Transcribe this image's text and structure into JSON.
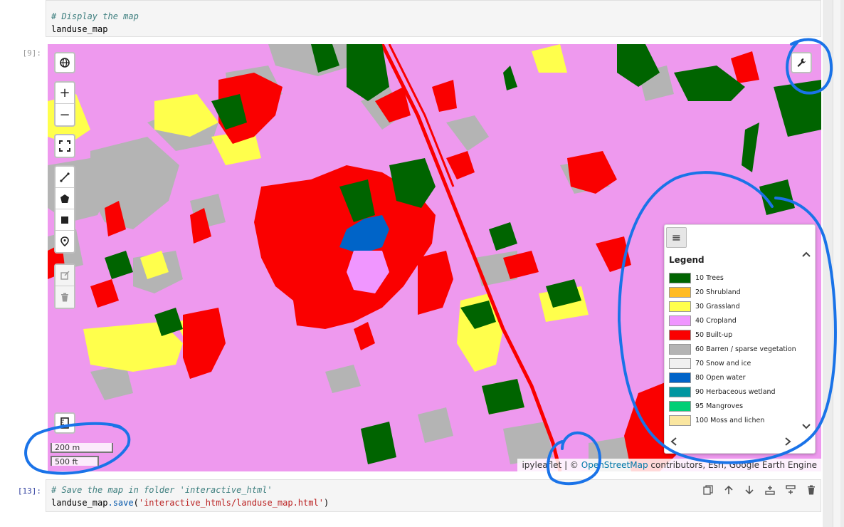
{
  "cells": {
    "prev": {
      "comment": "# Display the map",
      "code": "landuse_map"
    },
    "out_prompt": "[9]:",
    "next": {
      "prompt": "[13]:",
      "comment": "# Save the map in folder 'interactive_html'",
      "code_obj": "landuse_map",
      "code_fn": ".save",
      "code_open": "(",
      "code_arg": "'interactive_htmls/landuse_map.html'",
      "code_close": ")"
    }
  },
  "map": {
    "controls": {
      "globe_icon": "globe-icon",
      "zoom_in": "+",
      "zoom_out": "−",
      "wrench_icon": "wrench-icon"
    },
    "scale": {
      "metric": "200 m",
      "imperial": "500 ft"
    },
    "attribution": {
      "prefix": "ipyleaflet",
      "sep": " | © ",
      "link": "OpenStreetMap",
      "rest": " contributors, Esri, Google Earth Engine"
    },
    "legend": {
      "title": "Legend",
      "items": [
        {
          "label": "10 Trees",
          "color": "#006400"
        },
        {
          "label": "20 Shrubland",
          "color": "#ffbb22"
        },
        {
          "label": "30 Grassland",
          "color": "#ffff4c"
        },
        {
          "label": "40 Cropland",
          "color": "#f096ff"
        },
        {
          "label": "50 Built-up",
          "color": "#fa0000"
        },
        {
          "label": "60 Barren / sparse vegetation",
          "color": "#b4b4b4"
        },
        {
          "label": "70 Snow and ice",
          "color": "#f0f0f0"
        },
        {
          "label": "80 Open water",
          "color": "#0064c8"
        },
        {
          "label": "90 Herbaceous wetland",
          "color": "#0096a0"
        },
        {
          "label": "95 Mangroves",
          "color": "#00cf75"
        },
        {
          "label": "100 Moss and lichen",
          "color": "#fae6a0"
        }
      ]
    }
  },
  "colors": {
    "annotation": "#1a73e8"
  }
}
